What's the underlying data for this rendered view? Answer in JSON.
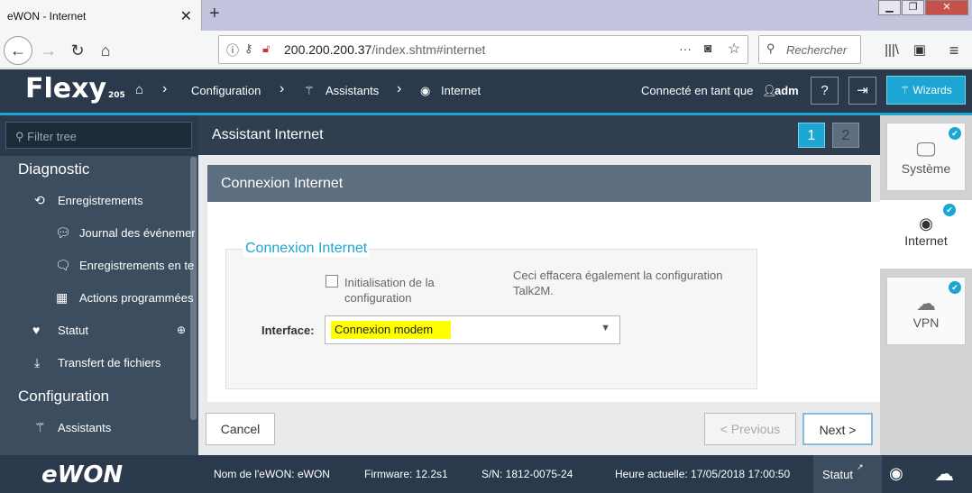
{
  "browser": {
    "tab_title": "eWON - Internet",
    "tab_close": "✕",
    "new_tab": "+",
    "url_host": "200.200.200.37",
    "url_path": "/index.shtm#internet",
    "search_placeholder": "Rechercher"
  },
  "header": {
    "logo": "Flexy",
    "logo_model": "205",
    "breadcrumb": [
      "Configuration",
      "Assistants",
      "Internet"
    ],
    "user_prefix": "Connecté en tant que",
    "user": "adm",
    "wizards_label": "Wizards"
  },
  "sidebar": {
    "filter_placeholder": "Filter tree",
    "section1": "Diagnostic",
    "items1": [
      {
        "label": "Enregistrements",
        "icon": "history-icon"
      },
      {
        "label": "Journal des événements",
        "icon": "comment-icon"
      },
      {
        "label": "Enregistrements en temps réel",
        "icon": "comments-icon"
      },
      {
        "label": "Actions programmées",
        "icon": "calendar-icon"
      },
      {
        "label": "Statut",
        "icon": "heartbeat-icon"
      },
      {
        "label": "Transfert de fichiers",
        "icon": "download-icon"
      }
    ],
    "section2": "Configuration",
    "items2": [
      {
        "label": "Assistants",
        "icon": "magic-wand-icon"
      }
    ],
    "brand": "eWON"
  },
  "main": {
    "title": "Assistant Internet",
    "steps": [
      "1",
      "2"
    ],
    "panel_title": "Connexion Internet",
    "fieldset_legend": "Connexion Internet",
    "checkbox_label": "Initialisation de la configuration",
    "checkbox_checked": false,
    "note": "Ceci effacera également la configuration Talk2M.",
    "interface_label": "Interface:",
    "interface_value": "Connexion modem",
    "cancel": "Cancel",
    "previous": "< Previous",
    "next": "Next >"
  },
  "wizard_steps": [
    {
      "label": "Système",
      "icon": "monitor-icon",
      "done": true
    },
    {
      "label": "Internet",
      "icon": "globe-icon",
      "done": true
    },
    {
      "label": "VPN",
      "icon": "cloud-icon",
      "done": true
    }
  ],
  "status": {
    "name": "Nom de l'eWON: eWON",
    "firmware": "Firmware: 12.2s1",
    "serial": "S/N: 1812-0075-24",
    "time": "Heure actuelle: 17/05/2018 17:00:50",
    "statut": "Statut"
  },
  "colors": {
    "accent": "#1ba6d3",
    "header_bg": "#2a3a4c",
    "highlight": "#ffff00"
  }
}
